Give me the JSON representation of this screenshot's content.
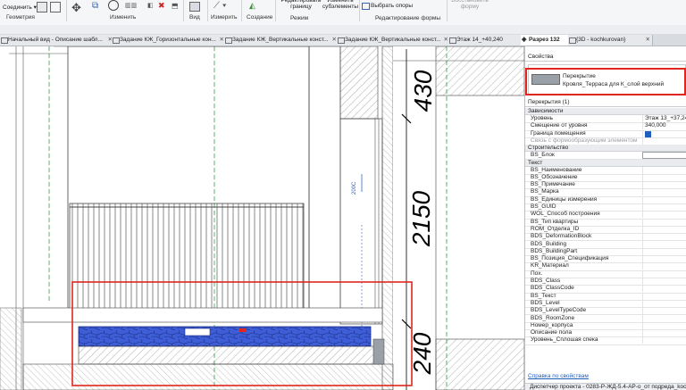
{
  "ribbon": {
    "connect_label": "Соединить",
    "geometry_label": "Геометрия",
    "modify_label": "Изменить",
    "view_label": "Вид",
    "measure_label": "Измерить",
    "create_label": "Создание",
    "edit_boundary_label": "Редактировать границу",
    "edit_subelements_label": "Изменить субэлементы",
    "mode_label": "Режим",
    "pick_supports_label": "Выбрать опоры",
    "edit_form_label": "Редактирование формы",
    "reset_form_label": "Восстановить форму"
  },
  "tabs": [
    {
      "label": "Начальный вид - Описание шабл...",
      "active": false
    },
    {
      "label": "Задание КЖ_Горизонтальные кон...",
      "active": false
    },
    {
      "label": "Задание КЖ_Вертикальные конст...",
      "active": false
    },
    {
      "label": "Задание КЖ_Вертикальные конст...",
      "active": false
    },
    {
      "label": "Этаж 14_+40,240",
      "active": false
    },
    {
      "label": "Разрез 132",
      "active": true
    },
    {
      "label": "{3D - kochkurovan}",
      "active": false
    }
  ],
  "drawing": {
    "dim_top": "430",
    "dim_mid": "2150",
    "dim_bottom": "240",
    "door_tag": "200С",
    "highlight_color": "#e0261f",
    "fill_color": "#3d5ed6"
  },
  "properties": {
    "title": "Свойства",
    "type_family": "Перекрытие",
    "type_name": "Кровля_Терраса для К_слой верхний",
    "selector": "Перекрытия (1)",
    "groups": [
      {
        "name": "Зависимости",
        "rows": [
          {
            "key": "Уровень",
            "value": "Этаж 13_+37,240"
          },
          {
            "key": "Смещение от уровня",
            "value": "340,000"
          },
          {
            "key": "Граница помещения",
            "value": "",
            "checkbox": true,
            "checked": true
          },
          {
            "key": "Связь с формообразующим элементом",
            "value": "",
            "disabled": true
          }
        ]
      },
      {
        "name": "Строительство",
        "rows": [
          {
            "key": "BS_Блок",
            "value": ""
          }
        ]
      },
      {
        "name": "Текст",
        "rows": [
          {
            "key": "BS_Наименование",
            "value": ""
          },
          {
            "key": "BS_Обозначение",
            "value": ""
          },
          {
            "key": "BS_Примечание",
            "value": ""
          },
          {
            "key": "BS_Марка",
            "value": ""
          },
          {
            "key": "BS_Единицы измерения",
            "value": ""
          },
          {
            "key": "BS_GUID",
            "value": ""
          },
          {
            "key": "WOL_Способ построения",
            "value": ""
          },
          {
            "key": "BS_Тип квартиры",
            "value": ""
          },
          {
            "key": "ROM_Отделка_ID",
            "value": ""
          },
          {
            "key": "BDS_DeformationBlock",
            "value": ""
          },
          {
            "key": "BDS_Building",
            "value": ""
          },
          {
            "key": "BDS_BuildingPart",
            "value": ""
          },
          {
            "key": "BS_Позиция_Спецификация",
            "value": ""
          },
          {
            "key": "KR_Материал",
            "value": ""
          },
          {
            "key": "Пох.",
            "value": ""
          },
          {
            "key": "BDS_Class",
            "value": ""
          },
          {
            "key": "BDS_ClassCode",
            "value": ""
          },
          {
            "key": "BS_Текст",
            "value": ""
          },
          {
            "key": "BDS_Level",
            "value": ""
          },
          {
            "key": "BDS_LevelTypeCode",
            "value": ""
          },
          {
            "key": "BDS_RoomZone",
            "value": ""
          },
          {
            "key": "Номер_корпуса",
            "value": ""
          },
          {
            "key": "Описание пола",
            "value": ""
          },
          {
            "key": "Уровень_Сплошая спека",
            "value": ""
          }
        ]
      }
    ],
    "help_link": "Справка по свойствам",
    "project_browser": "Диспетчер проекта - 0283-Р-ЖД-5.4-АР-о_от подреда_kochkurovan"
  }
}
